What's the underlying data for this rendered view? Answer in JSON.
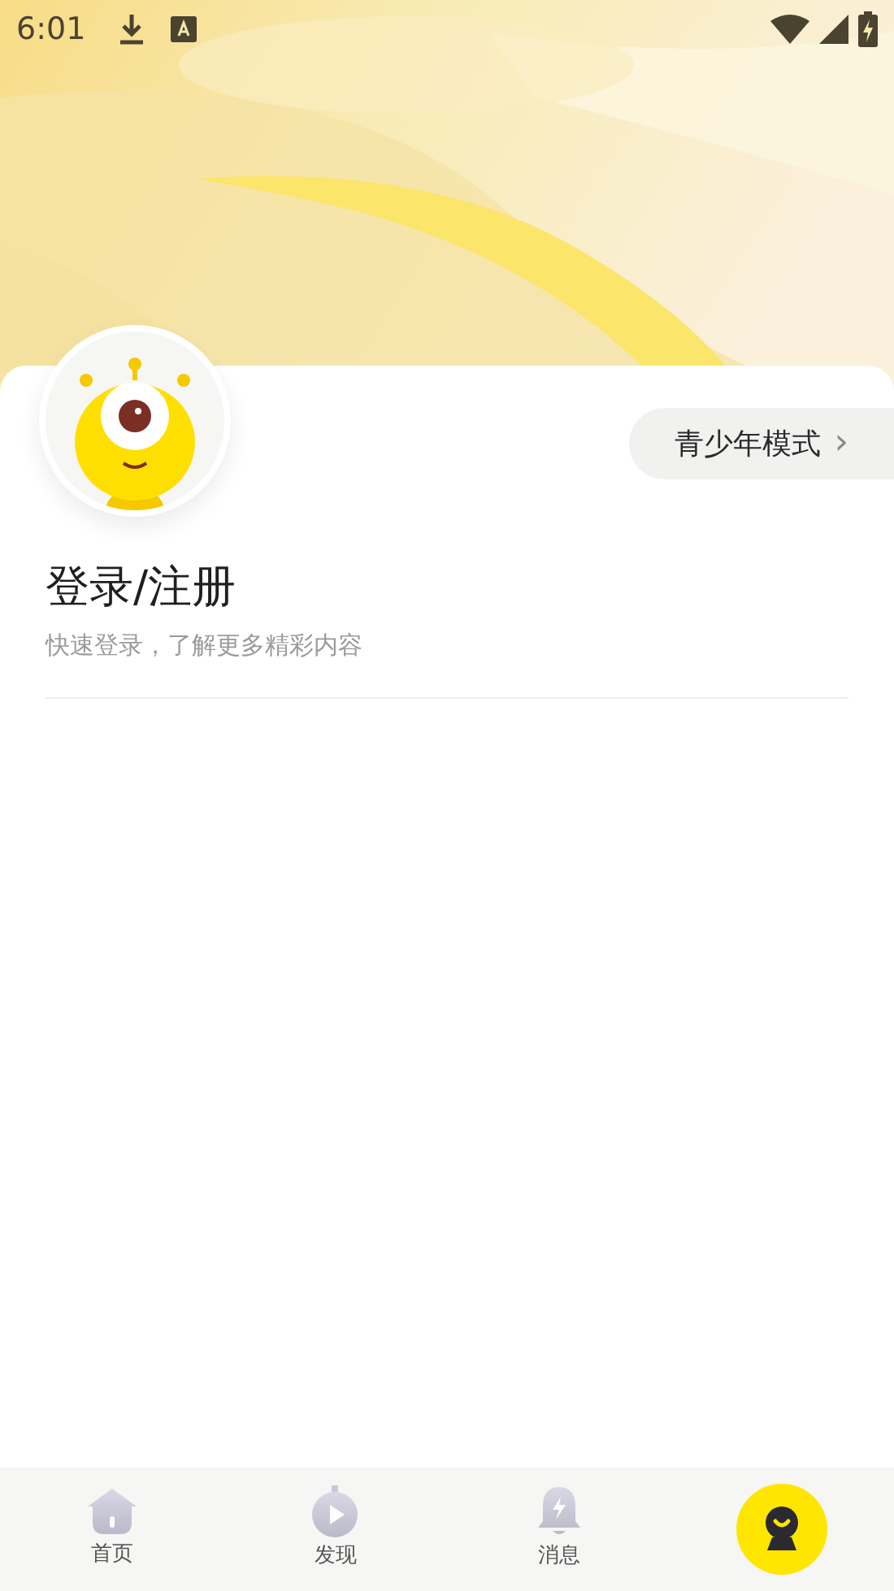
{
  "status_bar": {
    "time": "6:01"
  },
  "youth_mode": {
    "label": "青少年模式",
    "chevron": "›"
  },
  "login": {
    "title": "登录/注册",
    "subtitle": "快速登录，了解更多精彩内容"
  },
  "bottom_nav": [
    {
      "kind": "home",
      "label": "首页",
      "selected": false
    },
    {
      "kind": "discover",
      "label": "发现",
      "selected": false
    },
    {
      "kind": "messages",
      "label": "消息",
      "selected": false
    },
    {
      "kind": "me",
      "selected": true
    }
  ]
}
